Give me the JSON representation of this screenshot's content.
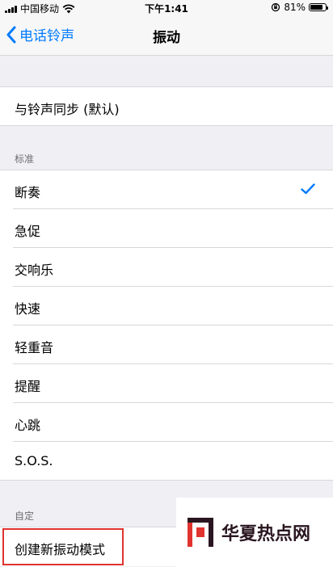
{
  "status_bar": {
    "carrier": "中国移动",
    "time": "下午1:41",
    "battery_pct": "81%",
    "battery_level": 0.81
  },
  "nav": {
    "back_label": "电话铃声",
    "title": "振动"
  },
  "sync_item": {
    "label": "与铃声同步 (默认)"
  },
  "standard_section": {
    "header": "标准",
    "items": [
      {
        "label": "断奏",
        "selected": true
      },
      {
        "label": "急促"
      },
      {
        "label": "交响乐"
      },
      {
        "label": "快速"
      },
      {
        "label": "轻重音"
      },
      {
        "label": "提醒"
      },
      {
        "label": "心跳"
      },
      {
        "label": "S.O.S."
      }
    ]
  },
  "custom_section": {
    "header": "自定",
    "create_label": "创建新振动模式"
  },
  "watermark": {
    "text": "华夏热点网"
  },
  "colors": {
    "accent": "#007aff",
    "highlight": "#e0332f",
    "background": "#efeff4"
  }
}
